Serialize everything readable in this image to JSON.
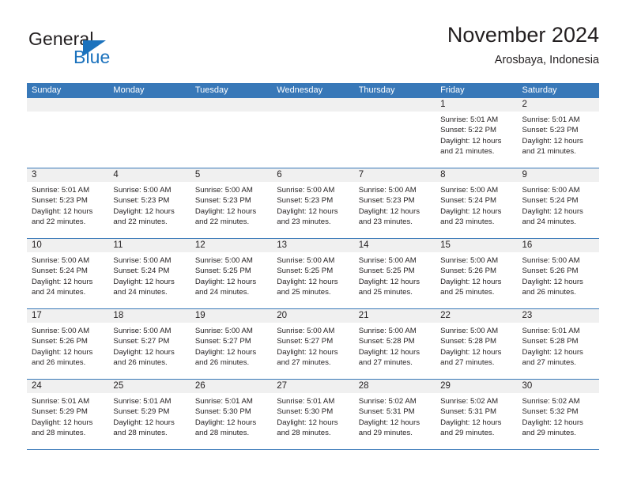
{
  "brand": {
    "name_part1": "General",
    "name_part2": "Blue",
    "logo_icon": "triangle-icon"
  },
  "header": {
    "month_title": "November 2024",
    "location": "Arosbaya, Indonesia"
  },
  "theme": {
    "header_blue": "#3878b8",
    "brand_blue": "#1b72bd",
    "daynum_band": "#f0f0f0",
    "text": "#231f20"
  },
  "calendar": {
    "weekday_headers": [
      "Sunday",
      "Monday",
      "Tuesday",
      "Wednesday",
      "Thursday",
      "Friday",
      "Saturday"
    ],
    "weeks": [
      [
        {
          "day": "",
          "lines": []
        },
        {
          "day": "",
          "lines": []
        },
        {
          "day": "",
          "lines": []
        },
        {
          "day": "",
          "lines": []
        },
        {
          "day": "",
          "lines": []
        },
        {
          "day": "1",
          "lines": [
            "Sunrise: 5:01 AM",
            "Sunset: 5:22 PM",
            "Daylight: 12 hours",
            "and 21 minutes."
          ]
        },
        {
          "day": "2",
          "lines": [
            "Sunrise: 5:01 AM",
            "Sunset: 5:23 PM",
            "Daylight: 12 hours",
            "and 21 minutes."
          ]
        }
      ],
      [
        {
          "day": "3",
          "lines": [
            "Sunrise: 5:01 AM",
            "Sunset: 5:23 PM",
            "Daylight: 12 hours",
            "and 22 minutes."
          ]
        },
        {
          "day": "4",
          "lines": [
            "Sunrise: 5:00 AM",
            "Sunset: 5:23 PM",
            "Daylight: 12 hours",
            "and 22 minutes."
          ]
        },
        {
          "day": "5",
          "lines": [
            "Sunrise: 5:00 AM",
            "Sunset: 5:23 PM",
            "Daylight: 12 hours",
            "and 22 minutes."
          ]
        },
        {
          "day": "6",
          "lines": [
            "Sunrise: 5:00 AM",
            "Sunset: 5:23 PM",
            "Daylight: 12 hours",
            "and 23 minutes."
          ]
        },
        {
          "day": "7",
          "lines": [
            "Sunrise: 5:00 AM",
            "Sunset: 5:23 PM",
            "Daylight: 12 hours",
            "and 23 minutes."
          ]
        },
        {
          "day": "8",
          "lines": [
            "Sunrise: 5:00 AM",
            "Sunset: 5:24 PM",
            "Daylight: 12 hours",
            "and 23 minutes."
          ]
        },
        {
          "day": "9",
          "lines": [
            "Sunrise: 5:00 AM",
            "Sunset: 5:24 PM",
            "Daylight: 12 hours",
            "and 24 minutes."
          ]
        }
      ],
      [
        {
          "day": "10",
          "lines": [
            "Sunrise: 5:00 AM",
            "Sunset: 5:24 PM",
            "Daylight: 12 hours",
            "and 24 minutes."
          ]
        },
        {
          "day": "11",
          "lines": [
            "Sunrise: 5:00 AM",
            "Sunset: 5:24 PM",
            "Daylight: 12 hours",
            "and 24 minutes."
          ]
        },
        {
          "day": "12",
          "lines": [
            "Sunrise: 5:00 AM",
            "Sunset: 5:25 PM",
            "Daylight: 12 hours",
            "and 24 minutes."
          ]
        },
        {
          "day": "13",
          "lines": [
            "Sunrise: 5:00 AM",
            "Sunset: 5:25 PM",
            "Daylight: 12 hours",
            "and 25 minutes."
          ]
        },
        {
          "day": "14",
          "lines": [
            "Sunrise: 5:00 AM",
            "Sunset: 5:25 PM",
            "Daylight: 12 hours",
            "and 25 minutes."
          ]
        },
        {
          "day": "15",
          "lines": [
            "Sunrise: 5:00 AM",
            "Sunset: 5:26 PM",
            "Daylight: 12 hours",
            "and 25 minutes."
          ]
        },
        {
          "day": "16",
          "lines": [
            "Sunrise: 5:00 AM",
            "Sunset: 5:26 PM",
            "Daylight: 12 hours",
            "and 26 minutes."
          ]
        }
      ],
      [
        {
          "day": "17",
          "lines": [
            "Sunrise: 5:00 AM",
            "Sunset: 5:26 PM",
            "Daylight: 12 hours",
            "and 26 minutes."
          ]
        },
        {
          "day": "18",
          "lines": [
            "Sunrise: 5:00 AM",
            "Sunset: 5:27 PM",
            "Daylight: 12 hours",
            "and 26 minutes."
          ]
        },
        {
          "day": "19",
          "lines": [
            "Sunrise: 5:00 AM",
            "Sunset: 5:27 PM",
            "Daylight: 12 hours",
            "and 26 minutes."
          ]
        },
        {
          "day": "20",
          "lines": [
            "Sunrise: 5:00 AM",
            "Sunset: 5:27 PM",
            "Daylight: 12 hours",
            "and 27 minutes."
          ]
        },
        {
          "day": "21",
          "lines": [
            "Sunrise: 5:00 AM",
            "Sunset: 5:28 PM",
            "Daylight: 12 hours",
            "and 27 minutes."
          ]
        },
        {
          "day": "22",
          "lines": [
            "Sunrise: 5:00 AM",
            "Sunset: 5:28 PM",
            "Daylight: 12 hours",
            "and 27 minutes."
          ]
        },
        {
          "day": "23",
          "lines": [
            "Sunrise: 5:01 AM",
            "Sunset: 5:28 PM",
            "Daylight: 12 hours",
            "and 27 minutes."
          ]
        }
      ],
      [
        {
          "day": "24",
          "lines": [
            "Sunrise: 5:01 AM",
            "Sunset: 5:29 PM",
            "Daylight: 12 hours",
            "and 28 minutes."
          ]
        },
        {
          "day": "25",
          "lines": [
            "Sunrise: 5:01 AM",
            "Sunset: 5:29 PM",
            "Daylight: 12 hours",
            "and 28 minutes."
          ]
        },
        {
          "day": "26",
          "lines": [
            "Sunrise: 5:01 AM",
            "Sunset: 5:30 PM",
            "Daylight: 12 hours",
            "and 28 minutes."
          ]
        },
        {
          "day": "27",
          "lines": [
            "Sunrise: 5:01 AM",
            "Sunset: 5:30 PM",
            "Daylight: 12 hours",
            "and 28 minutes."
          ]
        },
        {
          "day": "28",
          "lines": [
            "Sunrise: 5:02 AM",
            "Sunset: 5:31 PM",
            "Daylight: 12 hours",
            "and 29 minutes."
          ]
        },
        {
          "day": "29",
          "lines": [
            "Sunrise: 5:02 AM",
            "Sunset: 5:31 PM",
            "Daylight: 12 hours",
            "and 29 minutes."
          ]
        },
        {
          "day": "30",
          "lines": [
            "Sunrise: 5:02 AM",
            "Sunset: 5:32 PM",
            "Daylight: 12 hours",
            "and 29 minutes."
          ]
        }
      ]
    ]
  }
}
